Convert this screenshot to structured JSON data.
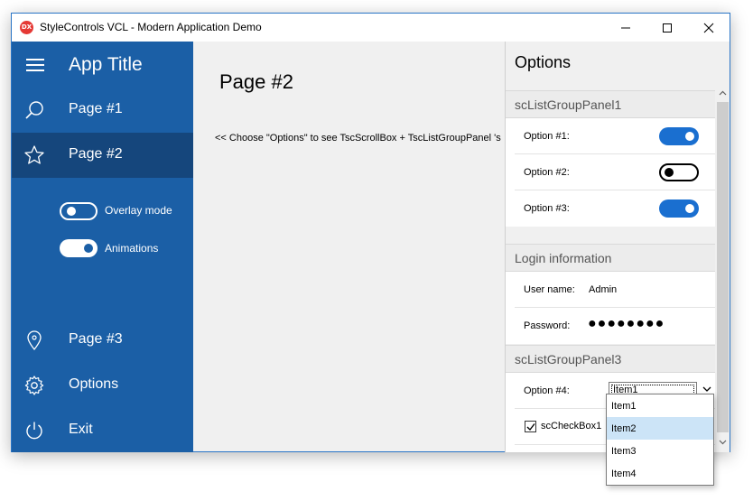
{
  "window": {
    "title": "StyleControls VCL - Modern Application Demo",
    "icon_text": "DX"
  },
  "sidebar": {
    "app_title": "App Title",
    "items": [
      {
        "label": "Page #1",
        "icon": "search-icon"
      },
      {
        "label": "Page #2",
        "icon": "star-icon",
        "active": true
      },
      {
        "label": "Page #3",
        "icon": "location-pin-icon"
      },
      {
        "label": "Options",
        "icon": "gear-icon"
      },
      {
        "label": "Exit",
        "icon": "power-icon"
      }
    ],
    "toggles": [
      {
        "label": "Overlay mode",
        "on": false
      },
      {
        "label": "Animations",
        "on": true
      }
    ]
  },
  "main": {
    "title": "Page #2",
    "hint": "<< Choose \"Options\"  to see  TscScrollBox + TscListGroupPanel 's"
  },
  "options_panel": {
    "title": "Options",
    "group1": {
      "header": "scListGroupPanel1",
      "options": [
        {
          "label": "Option #1:",
          "on": true
        },
        {
          "label": "Option #2:",
          "on": false
        },
        {
          "label": "Option #3:",
          "on": true
        }
      ]
    },
    "group2": {
      "header": "Login information",
      "user_label": "User name:",
      "user_value": "Admin",
      "password_label": "Password:",
      "password_value": "●●●●●●●●"
    },
    "group3": {
      "header": "scListGroupPanel3",
      "option4_label": "Option #4:",
      "combo_value": "Item1",
      "checkbox_label": "scCheckBox1",
      "checkbox_checked": true
    }
  },
  "dropdown": {
    "items": [
      "Item1",
      "Item2",
      "Item3",
      "Item4"
    ],
    "highlighted_index": 1
  },
  "colors": {
    "sidebar": "#1b5fa6",
    "sidebar_active": "#15467c",
    "toggle_on": "#1a6fd0",
    "dropdown_highlight": "#cce4f7"
  }
}
